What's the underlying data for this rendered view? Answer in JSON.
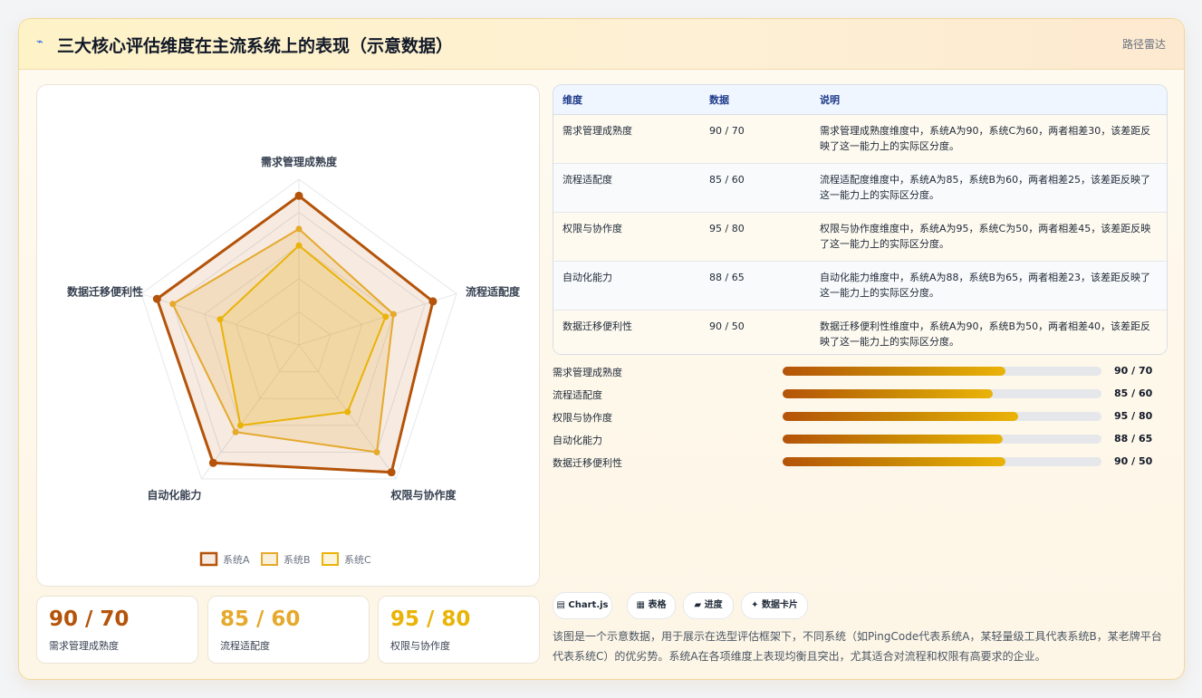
{
  "header": {
    "icon": "chart-trend-icon",
    "title": "三大核心评估维度在主流系统上的表现（示意数据）",
    "tag": "路径雷达"
  },
  "chart_data": {
    "type": "radar",
    "axes": [
      "需求管理成熟度",
      "流程适配度",
      "权限与协作度",
      "自动化能力",
      "数据迁移便利性"
    ],
    "rlim": [
      0,
      100
    ],
    "grid": true,
    "legend_position": "bottom",
    "series": [
      {
        "name": "系统A",
        "values": [
          90,
          85,
          95,
          88,
          90
        ],
        "color": "#b45309"
      },
      {
        "name": "系统B",
        "values": [
          70,
          60,
          80,
          65,
          80
        ],
        "color": "#e5a92c"
      },
      {
        "name": "系统C",
        "values": [
          60,
          55,
          50,
          60,
          50
        ],
        "color": "#eab308"
      }
    ]
  },
  "kpis": [
    {
      "value": "90 / 70",
      "label": "需求管理成熟度",
      "color": "#b45309"
    },
    {
      "value": "85 / 60",
      "label": "流程适配度",
      "color": "#e5a92c"
    },
    {
      "value": "95 / 80",
      "label": "权限与协作度",
      "color": "#eab308"
    }
  ],
  "table": {
    "headers": [
      "维度",
      "数据",
      "说明"
    ],
    "rows": [
      {
        "dim": "需求管理成熟度",
        "data": "90 / 70",
        "desc": "需求管理成熟度维度中，系统A为90，系统C为60，两者相差30，该差距反映了这一能力上的实际区分度。"
      },
      {
        "dim": "流程适配度",
        "data": "85 / 60",
        "desc": "流程适配度维度中，系统A为85，系统B为60，两者相差25，该差距反映了这一能力上的实际区分度。"
      },
      {
        "dim": "权限与协作度",
        "data": "95 / 80",
        "desc": "权限与协作度维度中，系统A为95，系统C为50，两者相差45，该差距反映了这一能力上的实际区分度。"
      },
      {
        "dim": "自动化能力",
        "data": "88 / 65",
        "desc": "自动化能力维度中，系统A为88，系统B为65，两者相差23，该差距反映了这一能力上的实际区分度。"
      },
      {
        "dim": "数据迁移便利性",
        "data": "90 / 50",
        "desc": "数据迁移便利性维度中，系统A为90，系统B为50，两者相差40，该差距反映了这一能力上的实际区分度。"
      }
    ]
  },
  "progress": [
    {
      "label": "需求管理成熟度",
      "value": "90 / 70",
      "fraction": 0.7
    },
    {
      "label": "流程适配度",
      "value": "85 / 60",
      "fraction": 0.66
    },
    {
      "label": "权限与协作度",
      "value": "95 / 80",
      "fraction": 0.74
    },
    {
      "label": "自动化能力",
      "value": "88 / 65",
      "fraction": 0.69
    },
    {
      "label": "数据迁移便利性",
      "value": "90 / 50",
      "fraction": 0.7
    }
  ],
  "chips": [
    {
      "icon": "table-icon",
      "glyph": "▤",
      "label": "Chart.js"
    },
    {
      "icon": "grid-icon",
      "glyph": "▦",
      "label": "表格"
    },
    {
      "icon": "progress-icon",
      "glyph": "▰",
      "label": "进度"
    },
    {
      "icon": "sparkle-icon",
      "glyph": "✦",
      "label": "数据卡片"
    }
  ],
  "note": "该图是一个示意数据，用于展示在选型评估框架下，不同系统（如PingCode代表系统A，某轻量级工具代表系统B，某老牌平台代表系统C）的优劣势。系统A在各项维度上表现均衡且突出，尤其适合对流程和权限有高要求的企业。"
}
